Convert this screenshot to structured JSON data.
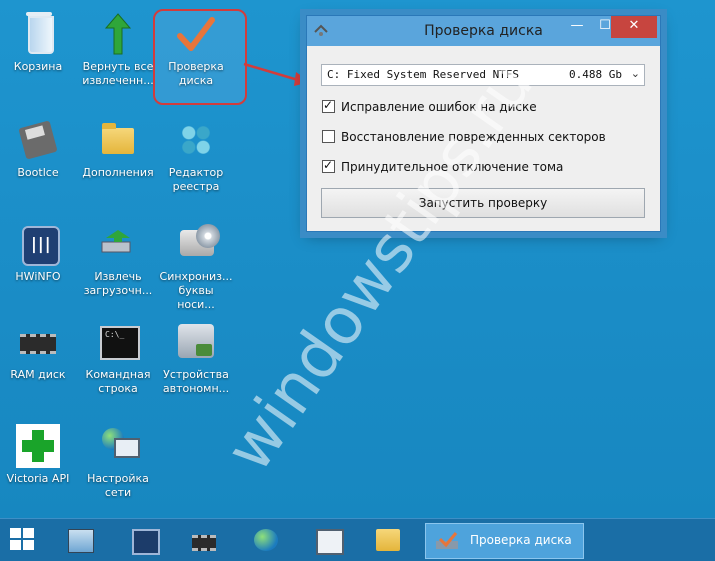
{
  "desktop": {
    "icons": [
      {
        "label": "Корзина"
      },
      {
        "label": "Вернуть все извлеченн..."
      },
      {
        "label": "Проверка диска"
      },
      {
        "label": "Bootlce"
      },
      {
        "label": "Дополнения"
      },
      {
        "label": "Редактор реестра"
      },
      {
        "label": "HWiNFO"
      },
      {
        "label": "Извлечь загрузочн..."
      },
      {
        "label": "Синхрониз... буквы носи..."
      },
      {
        "label": "RAM диск"
      },
      {
        "label": "Командная строка"
      },
      {
        "label": "Устройства автономн..."
      },
      {
        "label": "Victoria API"
      },
      {
        "label": "Настройка сети"
      }
    ]
  },
  "dialog": {
    "title": "Проверка диска",
    "drive": {
      "text": "C: Fixed System Reserved NTFS",
      "size": "0.488 Gb"
    },
    "options": [
      {
        "label": "Исправление ошибок на диске",
        "checked": true
      },
      {
        "label": "Восстановление поврежденных секторов",
        "checked": false
      },
      {
        "label": "Принудительное отключение тома",
        "checked": true
      }
    ],
    "run_button": "Запустить проверку",
    "window_buttons": {
      "minimize": "—",
      "maximize": "☐",
      "close": "✕"
    }
  },
  "watermark": "windowstips.ru",
  "taskbar": {
    "active_app": "Проверка диска"
  },
  "colors": {
    "desktop": "#1b8fc9",
    "taskbar": "#1a6ea6",
    "selection_border": "#d23c3c",
    "close_button": "#c7453f"
  }
}
